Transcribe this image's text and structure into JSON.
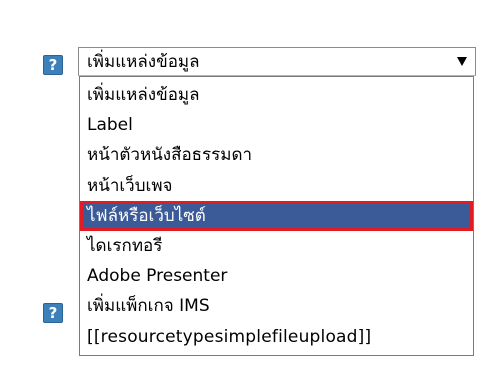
{
  "help_buttons": [
    {
      "glyph": "?"
    },
    {
      "glyph": "?"
    }
  ],
  "resource_select": {
    "selected_label": "เพิ่มแหล่งข้อมูล",
    "options": [
      {
        "label": "เพิ่มแหล่งข้อมูล"
      },
      {
        "label": "Label"
      },
      {
        "label": "หน้าตัวหนังสือธรรมดา"
      },
      {
        "label": "หน้าเว็บเพจ"
      },
      {
        "label": "ไฟล์หรือเว็บไซต์",
        "highlighted": true
      },
      {
        "label": "ไดเรกทอรี"
      },
      {
        "label": "Adobe Presenter"
      },
      {
        "label": "เพิ่มแพ็กเกจ IMS"
      },
      {
        "label": "[[resourcetypesimplefileupload]]"
      }
    ]
  },
  "colors": {
    "highlight_background": "#3b5b98",
    "highlight_border": "#e31b23",
    "help_button": "#3d7fb8"
  }
}
